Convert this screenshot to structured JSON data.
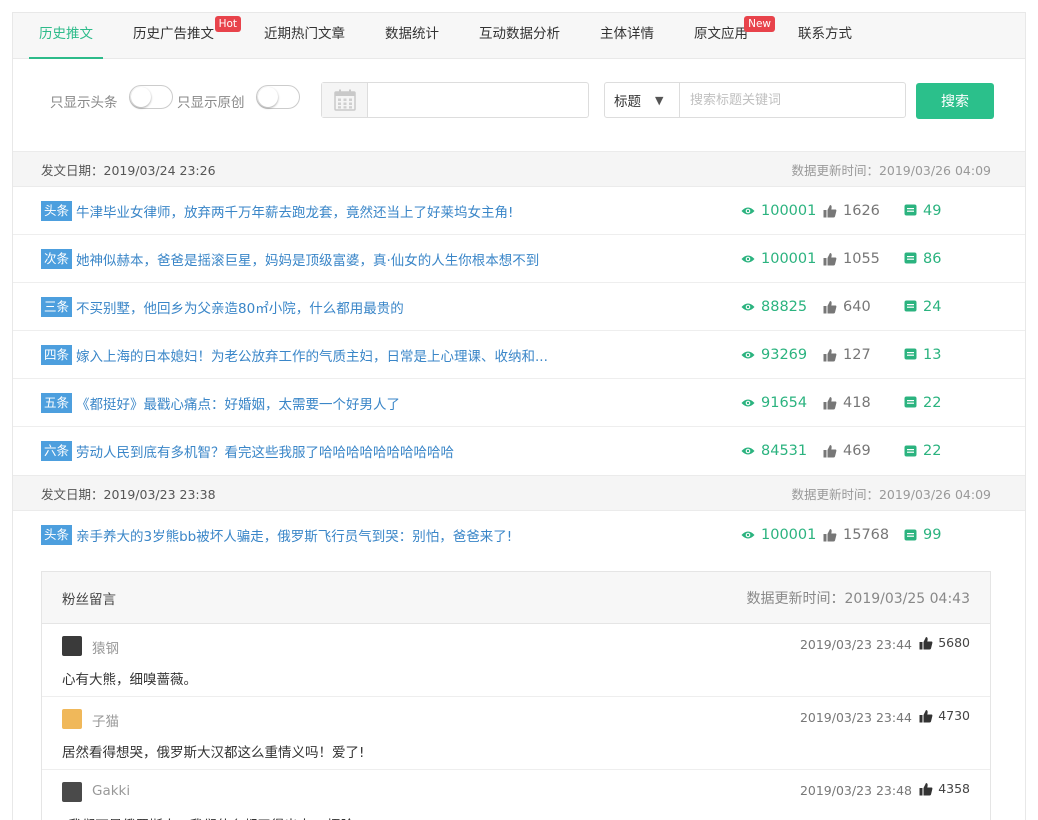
{
  "tabs": [
    {
      "label": "历史推文",
      "active": true,
      "badge": ""
    },
    {
      "label": "历史广告推文",
      "active": false,
      "badge": "Hot"
    },
    {
      "label": "近期热门文章",
      "active": false,
      "badge": ""
    },
    {
      "label": "数据统计",
      "active": false,
      "badge": ""
    },
    {
      "label": "互动数据分析",
      "active": false,
      "badge": ""
    },
    {
      "label": "主体详情",
      "active": false,
      "badge": ""
    },
    {
      "label": "原文应用",
      "active": false,
      "badge": "New"
    },
    {
      "label": "联系方式",
      "active": false,
      "badge": ""
    }
  ],
  "filters": {
    "toggle_headline_label": "只显示头条",
    "toggle_original_label": "只显示原创",
    "date_value": "",
    "select_value": "标题",
    "search_placeholder": "搜索标题关键词",
    "search_button": "搜索"
  },
  "days": [
    {
      "pub_label": "发文日期：2019/03/24 23:26",
      "update_label": "数据更新时间：2019/03/26 04:09",
      "articles": [
        {
          "pos": "头条",
          "title": "牛津毕业女律师，放弃两千万年薪去跑龙套，竟然还当上了好莱坞女主角!",
          "reads": "100001",
          "likes": "1626",
          "comments": "49"
        },
        {
          "pos": "次条",
          "title": "她神似赫本，爸爸是摇滚巨星，妈妈是顶级富婆，真·仙女的人生你根本想不到",
          "reads": "100001",
          "likes": "1055",
          "comments": "86"
        },
        {
          "pos": "三条",
          "title": "不买别墅，他回乡为父亲造80㎡小院，什么都用最贵的",
          "reads": "88825",
          "likes": "640",
          "comments": "24"
        },
        {
          "pos": "四条",
          "title": "嫁入上海的日本媳妇！为老公放弃工作的气质主妇，日常是上心理课、收纳和...",
          "reads": "93269",
          "likes": "127",
          "comments": "13"
        },
        {
          "pos": "五条",
          "title": "《都挺好》最戳心痛点：好婚姻，太需要一个好男人了",
          "reads": "91654",
          "likes": "418",
          "comments": "22"
        },
        {
          "pos": "六条",
          "title": "劳动人民到底有多机智？看完这些我服了哈哈哈哈哈哈哈哈哈哈",
          "reads": "84531",
          "likes": "469",
          "comments": "22"
        }
      ]
    },
    {
      "pub_label": "发文日期：2019/03/23 23:38",
      "update_label": "数据更新时间：2019/03/26 04:09",
      "articles": [
        {
          "pos": "头条",
          "title": "亲手养大的3岁熊bb被坏人骗走，俄罗斯飞行员气到哭：别怕，爸爸来了!",
          "reads": "100001",
          "likes": "15768",
          "comments": "99"
        }
      ]
    }
  ],
  "comments_panel": {
    "title": "粉丝留言",
    "update_label": "数据更新时间：2019/03/25 04:43",
    "items": [
      {
        "name": "猿钢",
        "avatar_color": "#3a3a3a",
        "time": "2019/03/23 23:44",
        "likes": "5680",
        "text": "心有大熊，细嗅蔷薇。"
      },
      {
        "name": "子猫",
        "avatar_color": "#f0b85a",
        "time": "2019/03/23 23:44",
        "likes": "4730",
        "text": "居然看得想哭，俄罗斯大汉都这么重情义吗！爱了!"
      },
      {
        "name": "Gakki",
        "avatar_color": "#4a4a4a",
        "time": "2019/03/23 23:48",
        "likes": "4358",
        "text": "\"我们可是俄罗斯人，我们什么都干得出来\" [捂脸]"
      }
    ]
  },
  "colors": {
    "accent": "#2bc08b",
    "link": "#3a86c8",
    "position_tag": "#4d9fde",
    "badge": "#e8434b"
  },
  "icons": {
    "read": "eye-icon",
    "like": "thumbs-up-icon",
    "comment": "comment-icon",
    "date": "calendar-icon"
  }
}
